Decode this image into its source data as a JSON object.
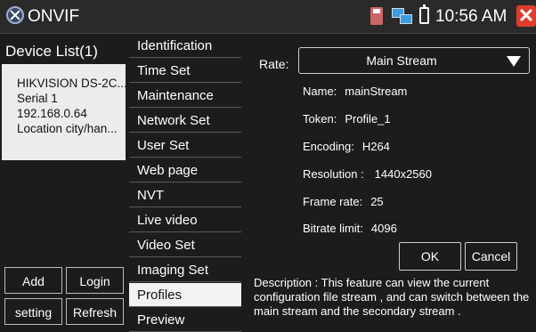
{
  "titlebar": {
    "app_title": "ONVIF",
    "app_icon": "onvif-app-icon",
    "status_icons": [
      "sd-card-icon",
      "network-icon",
      "battery-icon"
    ],
    "time": "10:56 AM",
    "close_icon": "close-x-icon",
    "close_color": "#e03c2c"
  },
  "left_panel": {
    "title": "Device List(1)",
    "device": {
      "name": "HIKVISION DS-2C...",
      "serial": "Serial  1",
      "ip": "192.168.0.64",
      "location": "Location  city/han..."
    },
    "buttons": {
      "add": "Add",
      "login": "Login",
      "setting": "setting",
      "refresh": "Refresh"
    }
  },
  "menu": {
    "items": [
      "Identification",
      "Time Set",
      "Maintenance",
      "Network Set",
      "User Set",
      "Web page",
      "NVT",
      "Live video",
      "Video Set",
      "Imaging Set",
      "Profiles",
      "Preview"
    ],
    "active": "Profiles"
  },
  "profile": {
    "rate_label": "Rate:",
    "rate_value": "Main Stream",
    "name_label": "Name:",
    "name_value": "mainStream",
    "token_label": "Token:",
    "token_value": "Profile_1",
    "encoding_label": "Encoding:",
    "encoding_value": "H264",
    "resolution_label": "Resolution :",
    "resolution_value": "1440x2560",
    "framerate_label": "Frame rate:",
    "framerate_value": "25",
    "bitrate_label": "Bitrate limit:",
    "bitrate_value": "4096",
    "ok": "OK",
    "cancel": "Cancel",
    "description": "Description : This feature can view the current configuration file stream , and can switch between the main stream and the secondary stream ."
  }
}
